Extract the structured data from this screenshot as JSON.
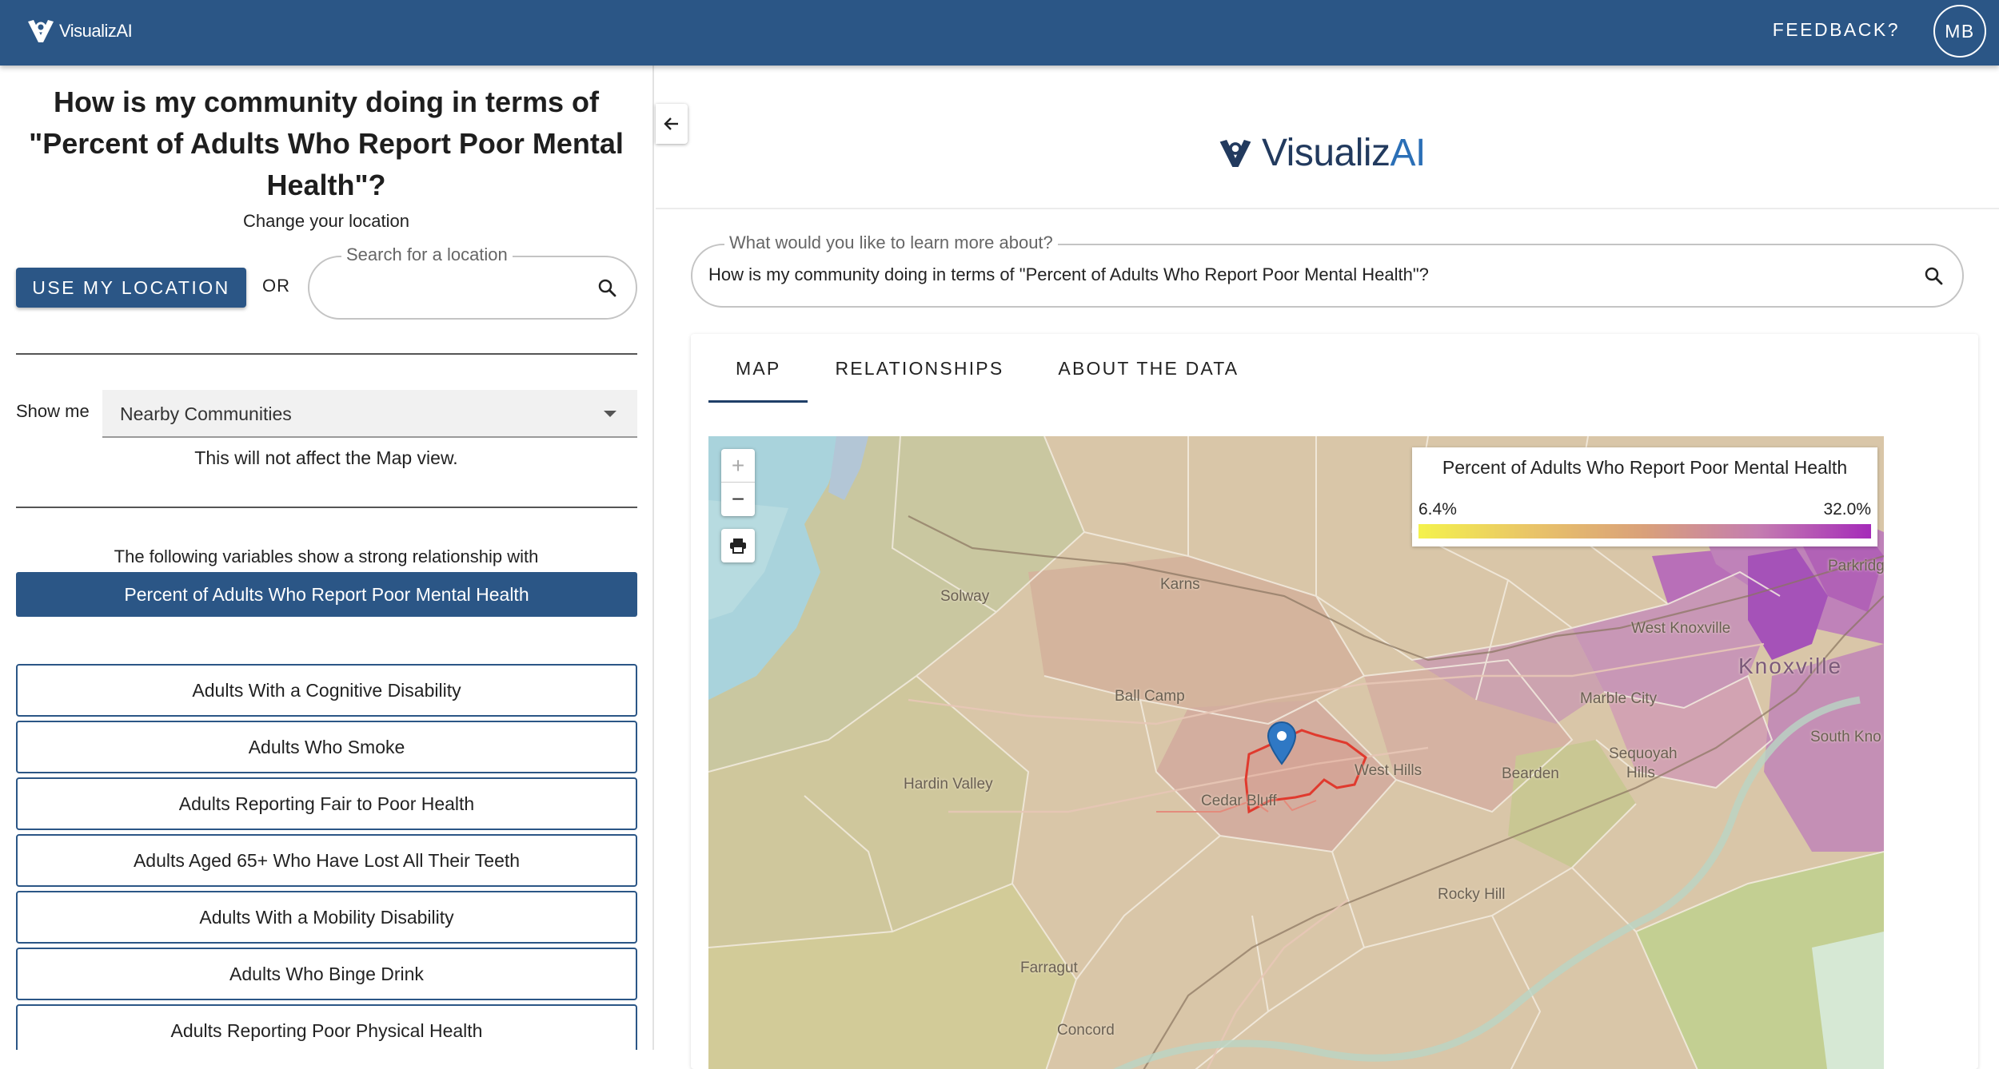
{
  "header": {
    "brand": "VisualizAI",
    "feedback_label": "FEEDBACK?",
    "avatar_initials": "MB"
  },
  "left_panel": {
    "question": "How is my community doing in terms of \"Percent of Adults Who Report Poor Mental Health\"?",
    "change_location_label": "Change your location",
    "use_location_button": "USE MY LOCATION",
    "or_label": "OR",
    "search_location": {
      "label": "Search for a location",
      "value": ""
    },
    "show_me_label": "Show me",
    "show_me_selected": "Nearby Communities",
    "show_me_note": "This will not affect the Map view.",
    "relationship_intro": "The following variables show a strong relationship with",
    "target_variable": "Percent of Adults Who Report Poor Mental Health",
    "related_variables": [
      "Adults With a Cognitive Disability",
      "Adults Who Smoke",
      "Adults Reporting Fair to Poor Health",
      "Adults Aged 65+ Who Have Lost All Their Teeth",
      "Adults With a Mobility Disability",
      "Adults Who Binge Drink",
      "Adults Reporting Poor Physical Health"
    ]
  },
  "right_panel": {
    "brand_prefix": "Visualiz",
    "brand_suffix": "AI",
    "ask": {
      "label": "What would you like to learn more about?",
      "value": "How is my community doing in terms of \"Percent of Adults Who Report Poor Mental Health\"?"
    },
    "tabs": [
      "MAP",
      "RELATIONSHIPS",
      "ABOUT THE DATA"
    ],
    "active_tab": "MAP",
    "map": {
      "legend_title": "Percent of Adults Who Report Poor Mental Health",
      "legend_min": "6.4%",
      "legend_max": "32.0%",
      "zoom_in": "+",
      "zoom_out": "−",
      "places": [
        "Solway",
        "Karns",
        "Ball Camp",
        "Hardin Valley",
        "Cedar Bluff",
        "West Hills",
        "Bearden",
        "Sequoyah Hills",
        "Marble City",
        "West Knoxville",
        "Knoxville",
        "Parkridge",
        "South Kno",
        "Rocky Hill",
        "Farragut",
        "Concord"
      ]
    }
  },
  "colors": {
    "header_bg": "#2b5686",
    "primary": "#2b5686",
    "legend_low": "#f4f24c",
    "legend_high": "#a52bb9",
    "selected_tract": "#e03a2e",
    "pin": "#2f78c4"
  },
  "icons": {
    "logo": "visualizai-logo-icon",
    "search": "search-icon",
    "collapse": "arrow-left-icon",
    "print": "print-icon",
    "pin": "map-pin-icon",
    "dropdown": "caret-down-icon"
  }
}
